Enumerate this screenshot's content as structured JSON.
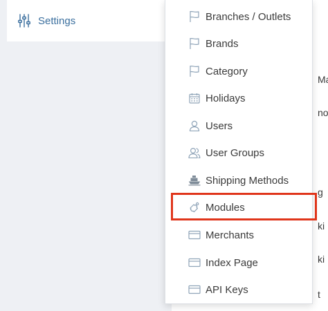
{
  "settings": {
    "label": "Settings",
    "icon": "sliders-icon",
    "accent_color": "#3b6f9e"
  },
  "dropdown": {
    "items": [
      {
        "label": "Branches / Outlets",
        "icon": "flag-icon"
      },
      {
        "label": "Brands",
        "icon": "flag-icon"
      },
      {
        "label": "Category",
        "icon": "flag-icon"
      },
      {
        "label": "Holidays",
        "icon": "calendar-icon"
      },
      {
        "label": "Users",
        "icon": "user-icon"
      },
      {
        "label": "User Groups",
        "icon": "user-group-icon"
      },
      {
        "label": "Shipping Methods",
        "icon": "ship-icon"
      },
      {
        "label": "Modules",
        "icon": "puzzle-icon"
      },
      {
        "label": "Merchants",
        "icon": "card-icon"
      },
      {
        "label": "Index Page",
        "icon": "card-icon"
      },
      {
        "label": "API Keys",
        "icon": "card-icon"
      }
    ],
    "highlighted_item": "Modules",
    "highlight_color": "#e0351b"
  },
  "background_fragments": [
    "Ma",
    "no",
    "g",
    "ki",
    "ki",
    "t"
  ]
}
